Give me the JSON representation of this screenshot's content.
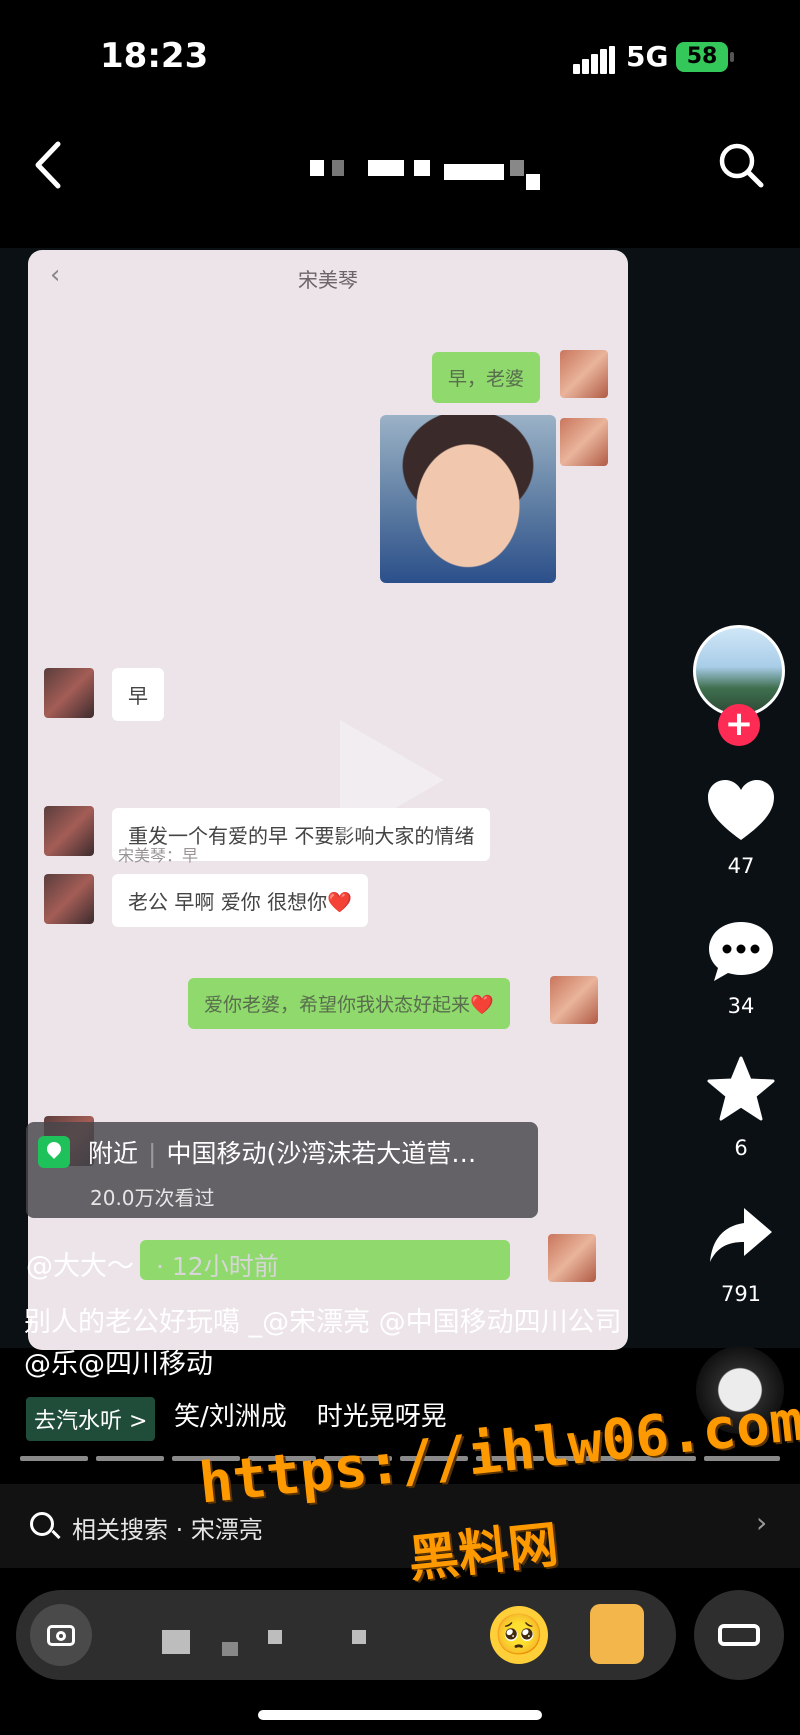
{
  "status": {
    "time": "18:23",
    "network": "5G",
    "battery": "58"
  },
  "nav": {
    "back_icon": "chevron-left-icon",
    "search_icon": "search-icon"
  },
  "chat": {
    "contact": "宋美琴",
    "messages": [
      {
        "side": "right",
        "text": "早，老婆"
      },
      {
        "side": "left",
        "text": "早"
      },
      {
        "side": "left",
        "text": "重发一个有爱的早 不要影响大家的情绪"
      },
      {
        "side": "left",
        "text": "老公 早啊 爱你 很想你❤️"
      },
      {
        "side": "left",
        "text": "宋美琴：早",
        "quote": true
      },
      {
        "side": "right",
        "text": "爱你老婆，希望你我状态好起来❤️"
      }
    ]
  },
  "rail": {
    "likes": "47",
    "comments": "34",
    "favorites": "6",
    "shares": "791",
    "follow_label": "+"
  },
  "location": {
    "tag": "附近",
    "name": "中国移动(沙湾沫若大道营…",
    "views": "20.0万次看过"
  },
  "post": {
    "author": "@大大～",
    "time": "· 12小时前",
    "caption": "别人的老公好玩噶 _@宋漂亮 @中国移动四川公司 @乐@四川移动",
    "music_tag": "去汽水听 >",
    "music_title": "笑/刘洲成",
    "music_next": "时光晃呀晃"
  },
  "watermark": {
    "line1": "https://ihlw06.com",
    "line2": "黑料网"
  },
  "related": {
    "label": "相关搜索 · 宋漂亮",
    "arrow": "›"
  },
  "bottom": {
    "camera_icon": "camera-icon",
    "sofa_icon": "sofa-icon",
    "emoji": "🥺"
  }
}
